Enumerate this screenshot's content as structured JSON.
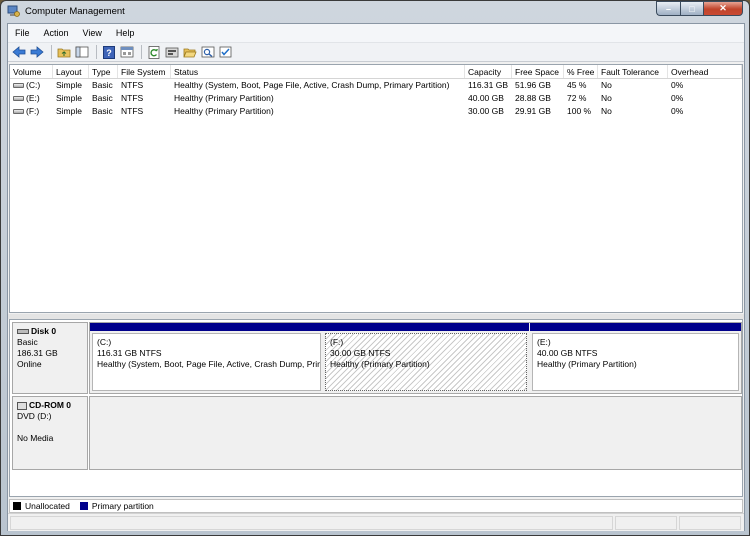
{
  "window": {
    "title": "Computer Management"
  },
  "menu": [
    "File",
    "Action",
    "View",
    "Help"
  ],
  "toolbar": {
    "icons": [
      "back-icon",
      "forward-icon",
      "up-folder-icon",
      "show-hide-tree-icon",
      "help-icon",
      "properties-icon",
      "refresh-icon",
      "settings-icon",
      "open-folder-icon",
      "search-icon",
      "checklist-icon"
    ]
  },
  "volume_list": {
    "columns": [
      "Volume",
      "Layout",
      "Type",
      "File System",
      "Status",
      "Capacity",
      "Free Space",
      "% Free",
      "Fault Tolerance",
      "Overhead"
    ],
    "rows": [
      [
        "(C:)",
        "Simple",
        "Basic",
        "NTFS",
        "Healthy (System, Boot, Page File, Active, Crash Dump, Primary Partition)",
        "116.31 GB",
        "51.96 GB",
        "45 %",
        "No",
        "0%"
      ],
      [
        "(E:)",
        "Simple",
        "Basic",
        "NTFS",
        "Healthy (Primary Partition)",
        "40.00 GB",
        "28.88 GB",
        "72 %",
        "No",
        "0%"
      ],
      [
        "(F:)",
        "Simple",
        "Basic",
        "NTFS",
        "Healthy (Primary Partition)",
        "30.00 GB",
        "29.91 GB",
        "100 %",
        "No",
        "0%"
      ]
    ]
  },
  "disks": [
    {
      "name": "Disk 0",
      "type": "Basic",
      "size": "186.31 GB",
      "state": "Online",
      "partitions": [
        {
          "label": "(C:)",
          "size": "116.31 GB NTFS",
          "status": "Healthy (System, Boot, Page File, Active, Crash Dump, Primary Partition)",
          "selected": false
        },
        {
          "label": "(F:)",
          "size": "30.00 GB NTFS",
          "status": "Healthy (Primary Partition)",
          "selected": true
        },
        {
          "label": "(E:)",
          "size": "40.00 GB NTFS",
          "status": "Healthy (Primary Partition)",
          "selected": false
        }
      ]
    },
    {
      "name": "CD-ROM 0",
      "type": "DVD (D:)",
      "state": "No Media"
    }
  ],
  "legend": [
    {
      "label": "Unallocated",
      "color": "#000000"
    },
    {
      "label": "Primary partition",
      "color": "#00008b"
    }
  ],
  "colors": {
    "partition_bar": "#00008b",
    "close_button": "#c0432a"
  }
}
